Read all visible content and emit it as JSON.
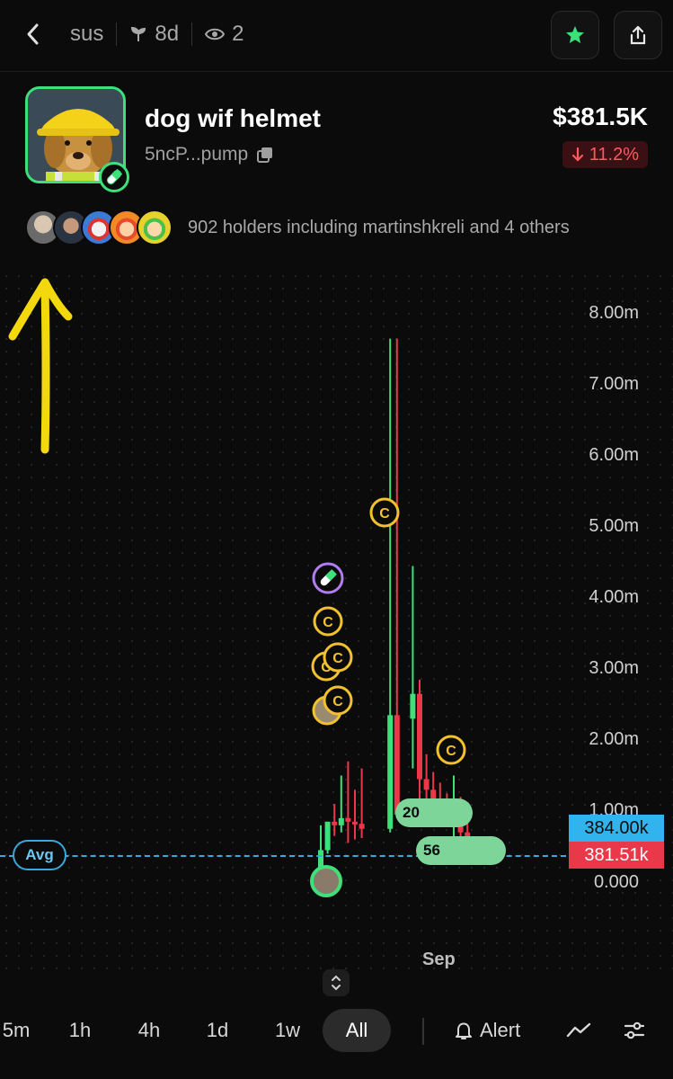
{
  "header": {
    "back_icon": "chevron-left-icon",
    "channel": "sus",
    "age": "8d",
    "age_icon": "sprout-icon",
    "watchers": "2",
    "watchers_icon": "eye-icon",
    "star_icon": "star-icon",
    "share_icon": "share-icon"
  },
  "token": {
    "name": "dog wif helmet",
    "address": "5ncP...pump",
    "copy_icon": "copy-icon",
    "price": "$381.5K",
    "change": "11.2%",
    "change_direction": "down",
    "platform_icon": "pill-icon"
  },
  "holders": {
    "text": "902 holders including martinshkreli and 4 others",
    "avatar_count": 5
  },
  "chart": {
    "y_labels": [
      "8.00m",
      "7.00m",
      "6.00m",
      "5.00m",
      "4.00m",
      "3.00m",
      "2.00m",
      "1.00m",
      "0.000"
    ],
    "avg_label": "Avg",
    "price_high": "384.00k",
    "price_last": "381.51k",
    "x_label": "Sep",
    "trade_pills": [
      "20",
      "56"
    ],
    "marker_letter": "C"
  },
  "chart_data": {
    "type": "candlestick",
    "ylabel": "",
    "xlabel": "",
    "ylim": [
      0,
      8000000
    ],
    "x_ticks": [
      "Sep"
    ],
    "candles": [
      {
        "open": 0.05,
        "high": 0.8,
        "low": 0.02,
        "close": 0.45
      },
      {
        "open": 0.45,
        "high": 0.85,
        "low": 0.4,
        "close": 0.85
      },
      {
        "open": 0.85,
        "high": 1.1,
        "low": 0.65,
        "close": 0.8
      },
      {
        "open": 0.8,
        "high": 1.5,
        "low": 0.7,
        "close": 0.9
      },
      {
        "open": 0.9,
        "high": 1.7,
        "low": 0.55,
        "close": 0.85
      },
      {
        "open": 0.85,
        "high": 1.3,
        "low": 0.6,
        "close": 0.82
      },
      {
        "open": 0.82,
        "high": 1.6,
        "low": 0.62,
        "close": 0.75
      },
      {
        "open": 0.75,
        "high": 7.65,
        "low": 0.7,
        "close": 2.35
      },
      {
        "open": 2.35,
        "high": 7.65,
        "low": 1.4,
        "close": 0.95
      },
      {
        "open": 2.3,
        "high": 4.45,
        "low": 1.6,
        "close": 2.65
      },
      {
        "open": 2.65,
        "high": 2.85,
        "low": 1.15,
        "close": 1.45
      },
      {
        "open": 1.45,
        "high": 1.8,
        "low": 1.1,
        "close": 1.3
      },
      {
        "open": 1.3,
        "high": 1.55,
        "low": 1.0,
        "close": 1.15
      },
      {
        "open": 1.15,
        "high": 1.4,
        "low": 0.9,
        "close": 1.0
      },
      {
        "open": 1.0,
        "high": 1.25,
        "low": 0.8,
        "close": 0.95
      },
      {
        "open": 0.95,
        "high": 1.5,
        "low": 0.6,
        "close": 1.05
      },
      {
        "open": 1.05,
        "high": 1.2,
        "low": 0.55,
        "close": 0.7
      },
      {
        "open": 0.7,
        "high": 0.9,
        "low": 0.35,
        "close": 0.42
      },
      {
        "open": 0.42,
        "high": 0.55,
        "low": 0.3,
        "close": 0.38
      }
    ],
    "average": 0.38,
    "units": "millions",
    "colors": {
      "up": "#3ee07a",
      "down": "#e8384a",
      "avg": "#3aa8d8",
      "marker": "#f2c12e"
    }
  },
  "timeframes": {
    "items": [
      "5m",
      "1h",
      "4h",
      "1d",
      "1w",
      "All"
    ],
    "active": "All",
    "alert_label": "Alert",
    "alert_icon": "bell-icon",
    "line_icon": "line-chart-icon",
    "settings_icon": "sliders-icon",
    "collapse_icon": "chevron-updown-icon"
  },
  "colors": {
    "accent": "#3ee07a",
    "negative": "#ff5a5f",
    "background": "#0b0b0b"
  }
}
